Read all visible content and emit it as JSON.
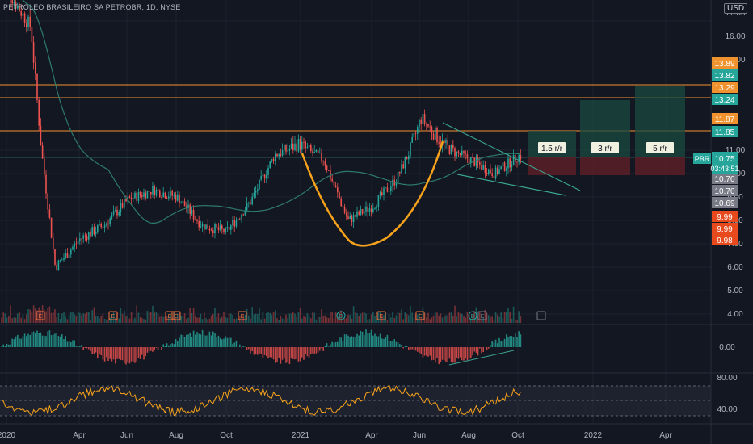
{
  "header": {
    "title": "PETROLEO BRASILEIRO SA PETROBR, 1D, NYSE",
    "currency": "USD"
  },
  "colors": {
    "bg": "#131722",
    "up": "#26a69a",
    "down": "#ef5350",
    "ma": "#2e7a6b",
    "hline": "#f0922e",
    "cup": "#f7a21b",
    "trend": "#3aa38f",
    "grid": "#1e222d"
  },
  "chart_data": [
    {
      "type": "line",
      "title": "PETROLEO BRASILEIRO SA PETROBR, 1D, NYSE",
      "x_ticks": [
        "2020",
        "Apr",
        "Jun",
        "Aug",
        "Oct",
        "2021",
        "Apr",
        "Jun",
        "Aug",
        "Oct",
        "2022",
        "Apr"
      ],
      "y_ticks": [
        "17.00",
        "16.00",
        "15.00",
        "11.00",
        "10.00",
        "9.00",
        "8.00",
        "7.00",
        "6.00",
        "5.00",
        "4.00"
      ],
      "ylim": [
        4,
        17
      ],
      "series": [
        {
          "name": "PBR",
          "x": [
            "2020-01",
            "2020-02",
            "2020-03",
            "2020-04",
            "2020-05",
            "2020-06",
            "2020-07",
            "2020-08",
            "2020-09",
            "2020-10",
            "2020-11",
            "2020-12",
            "2021-01",
            "2021-02",
            "2021-03",
            "2021-04",
            "2021-05",
            "2021-06",
            "2021-07",
            "2021-08",
            "2021-09",
            "2021-10"
          ],
          "y": [
            16.0,
            14.8,
            6.0,
            7.2,
            7.8,
            8.9,
            9.3,
            9.0,
            7.8,
            7.5,
            8.8,
            10.8,
            11.2,
            10.6,
            8.0,
            8.6,
            9.8,
            12.0,
            11.1,
            10.6,
            10.0,
            10.75
          ]
        }
      ],
      "price_labels": [
        {
          "value": "13.89",
          "color": "#f0922e"
        },
        {
          "value": "13.82",
          "color": "#26a69a"
        },
        {
          "value": "13.29",
          "color": "#f0922e"
        },
        {
          "value": "13.24",
          "color": "#26a69a"
        },
        {
          "value": "11.87",
          "color": "#f0922e"
        },
        {
          "value": "11.85",
          "color": "#26a69a"
        },
        {
          "value": "10.70",
          "color": "#787b86"
        },
        {
          "value": "10.70",
          "color": "#787b86"
        },
        {
          "value": "10.69",
          "color": "#787b86"
        },
        {
          "value": "9.99",
          "color": "#e8491d"
        },
        {
          "value": "9.99",
          "color": "#e8491d"
        },
        {
          "value": "9.98",
          "color": "#e8491d"
        }
      ],
      "current": {
        "symbol": "PBR",
        "price": "10.75",
        "countdown": "03:43:51"
      },
      "risk_reward": [
        "1.5 r/r",
        "3 r/r",
        "5 r/r"
      ],
      "event_markers": [
        "E",
        "E",
        "E",
        "E",
        "E",
        "D",
        "E",
        "E",
        "D",
        "E"
      ],
      "macd_ticks": [
        "0.00"
      ],
      "rsi_ticks": [
        "80.00",
        "40.00"
      ]
    }
  ]
}
